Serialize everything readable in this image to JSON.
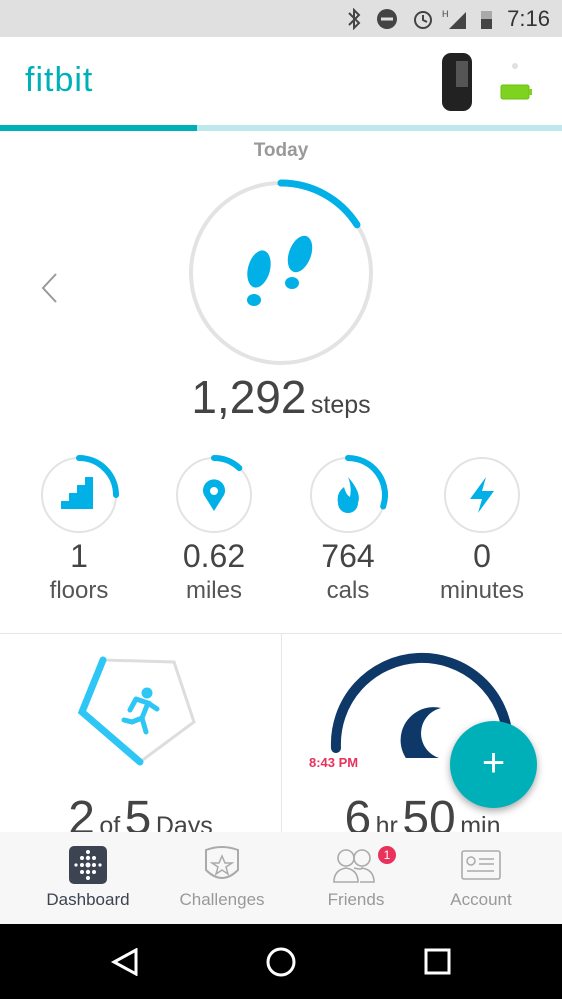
{
  "status_bar": {
    "time": "7:16",
    "icons": [
      "bluetooth-icon",
      "do-not-disturb-icon",
      "alarm-icon",
      "signal-h-icon",
      "battery-icon"
    ]
  },
  "header": {
    "logo": "fitbit",
    "device": "tracker-band-image",
    "device_battery_color": "#7ed321"
  },
  "tab_progress": {
    "fraction": 0.35,
    "accent": "#00b0b9",
    "track": "#bde9ec"
  },
  "main": {
    "day_label": "Today",
    "steps": {
      "value": "1,292",
      "unit": "steps",
      "progress": 0.16,
      "color": "#00b0e6"
    },
    "stats": [
      {
        "id": "floors",
        "value": "1",
        "label": "floors",
        "icon": "stairs-icon",
        "progress": 0.25
      },
      {
        "id": "miles",
        "value": "0.62",
        "label": "miles",
        "icon": "location-pin-icon",
        "progress": 0.12
      },
      {
        "id": "cals",
        "value": "764",
        "label": "cals",
        "icon": "flame-icon",
        "progress": 0.3
      },
      {
        "id": "minutes",
        "value": "0",
        "label": "minutes",
        "icon": "lightning-icon",
        "progress": 0
      }
    ],
    "exercise_card": {
      "count": "2",
      "of": "of",
      "total": "5",
      "unit": "Days",
      "progress": 0.4
    },
    "sleep_card": {
      "start_time": "8:43 PM",
      "hours": "6",
      "hr_unit": "hr",
      "minutes": "50",
      "min_unit": "min",
      "start_color": "#e8315b",
      "arc_color": "#0d3868"
    }
  },
  "fab": {
    "label": "+"
  },
  "bottom_nav": {
    "items": [
      {
        "label": "Dashboard",
        "active": true
      },
      {
        "label": "Challenges"
      },
      {
        "label": "Friends",
        "badge": "1"
      },
      {
        "label": "Account"
      }
    ]
  }
}
